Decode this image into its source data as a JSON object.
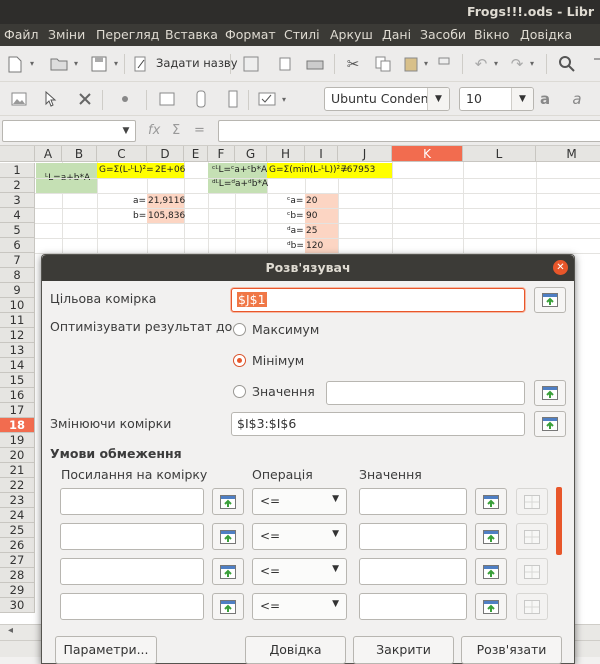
{
  "window": {
    "title": "Frogs!!!.ods - Libr"
  },
  "menu": [
    "Файл",
    "Зміни",
    "Перегляд",
    "Вставка",
    "Формат",
    "Стилі",
    "Аркуш",
    "Дані",
    "Засоби",
    "Вікно",
    "Довідка"
  ],
  "toolbar": {
    "set_name_label": "Задати назву",
    "font_name": "Ubuntu Conden",
    "font_size": "10"
  },
  "grid": {
    "columns": [
      "A",
      "B",
      "C",
      "D",
      "E",
      "F",
      "G",
      "H",
      "I",
      "J",
      "K",
      "L",
      "M"
    ],
    "selected_column": "K",
    "rows": [
      "1",
      "2",
      "3",
      "4",
      "5",
      "6",
      "7",
      "8",
      "9",
      "10",
      "11",
      "12",
      "13",
      "14",
      "15",
      "16",
      "17",
      "18",
      "19",
      "20",
      "21",
      "22",
      "23",
      "24",
      "25",
      "26",
      "27",
      "28",
      "29",
      "30"
    ],
    "selected_row": "18",
    "cells": {
      "a1": "ᴸL=a+b*A",
      "c1": "G=Σ(L-ᴸL)²=",
      "d1": "2E+06",
      "f1": "ᶜᴸL=ᶜa+ᶜb*A",
      "f2": "ᵈᴸL=ᵈa+ᵈb*A",
      "h1": "G=Σ(min(L-ᴸL))²=",
      "j1": "767953",
      "c3": "a=",
      "d3": "21,9116",
      "c4": "b=",
      "d4": "105,836",
      "h3": "ᶜa=",
      "i3": "20",
      "h4": "ᶜb=",
      "i4": "90",
      "h5": "ᵈa=",
      "i5": "25",
      "h6": "ᵈb=",
      "i6": "120"
    }
  },
  "dialog": {
    "title": "Розв'язувач",
    "target_cell_label": "Цільова комірка",
    "target_cell_value": "$J$1",
    "optimize_label": "Оптимізувати результат до",
    "radio_max": "Максимум",
    "radio_min": "Мінімум",
    "radio_value": "Значення",
    "selected_option": "min",
    "changing_cells_label": "Змінюючи комірки",
    "changing_cells_value": "$I$3:$I$6",
    "constraints_title": "Умови обмеження",
    "col_cell_ref": "Посилання на комірку",
    "col_operation": "Операція",
    "col_value": "Значення",
    "constraints": [
      {
        "cell": "",
        "op": "<=",
        "value": ""
      },
      {
        "cell": "",
        "op": "<=",
        "value": ""
      },
      {
        "cell": "",
        "op": "<=",
        "value": ""
      },
      {
        "cell": "",
        "op": "<=",
        "value": ""
      }
    ],
    "btn_options": "Параметри...",
    "btn_help": "Довідка",
    "btn_close": "Закрити",
    "btn_solve": "Розв'язати"
  },
  "icons": [
    "shrink-icon",
    "close-icon",
    "dropdown-arrow-icon"
  ],
  "colors": {
    "accent": "#e8562a",
    "cell_yellow": "#ffff00",
    "cell_green": "#c5e0b4",
    "cell_peach": "#fcd5c3"
  }
}
